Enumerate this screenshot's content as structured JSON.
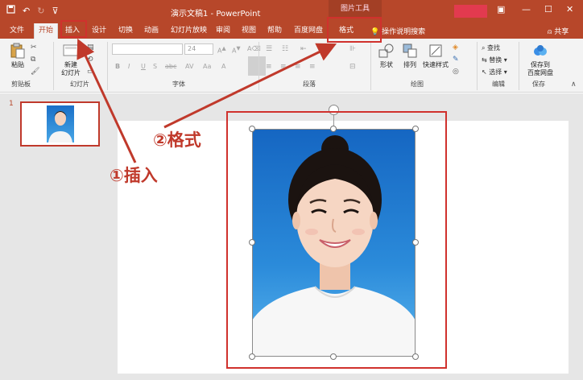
{
  "titlebar": {
    "title": "演示文稿1 - PowerPoint",
    "picture_tools_label": "图片工具",
    "qat_icons": [
      "save-icon",
      "undo-icon",
      "redo-icon",
      "customize-qat-icon"
    ],
    "window_controls": [
      "ribbon-display-icon",
      "minimize-icon",
      "maximize-icon",
      "close-icon"
    ]
  },
  "tabs": [
    {
      "label": "文件"
    },
    {
      "label": "开始",
      "active": true
    },
    {
      "label": "插入"
    },
    {
      "label": "设计"
    },
    {
      "label": "切换"
    },
    {
      "label": "动画"
    },
    {
      "label": "幻灯片放映"
    },
    {
      "label": "审阅"
    },
    {
      "label": "视图"
    },
    {
      "label": "帮助"
    },
    {
      "label": "百度网盘"
    },
    {
      "label": "格式"
    }
  ],
  "tell_me": "操作说明搜索",
  "share": "共享",
  "ribbon": {
    "clipboard": {
      "paste": "粘贴",
      "group_label": "剪贴板"
    },
    "slides": {
      "new_slide_line1": "新建",
      "new_slide_line2": "幻灯片",
      "group_label": "幻灯片"
    },
    "font": {
      "font_size": "24",
      "group_label": "字体",
      "buttons": [
        "B",
        "I",
        "U",
        "S",
        "abc",
        "AV",
        "Aa",
        "A"
      ]
    },
    "paragraph": {
      "group_label": "段落"
    },
    "drawing": {
      "shapes": "形状",
      "arrange": "排列",
      "quick_styles": "快速样式",
      "group_label": "绘图"
    },
    "editing": {
      "find": "查找",
      "replace": "替换",
      "select": "选择",
      "group_label": "编辑"
    },
    "save": {
      "line1": "保存到",
      "line2": "百度网盘",
      "group_label": "保存"
    }
  },
  "slide_pane": {
    "slide_number": "1"
  },
  "annotations": {
    "step1": "①插入",
    "step2": "②格式",
    "color": "#c0392b"
  },
  "colors": {
    "accent": "#b7472a",
    "ribbon_bg": "#f3f3f3",
    "workspace_bg": "#e6e6e6",
    "annotation_red": "#d0312d"
  }
}
